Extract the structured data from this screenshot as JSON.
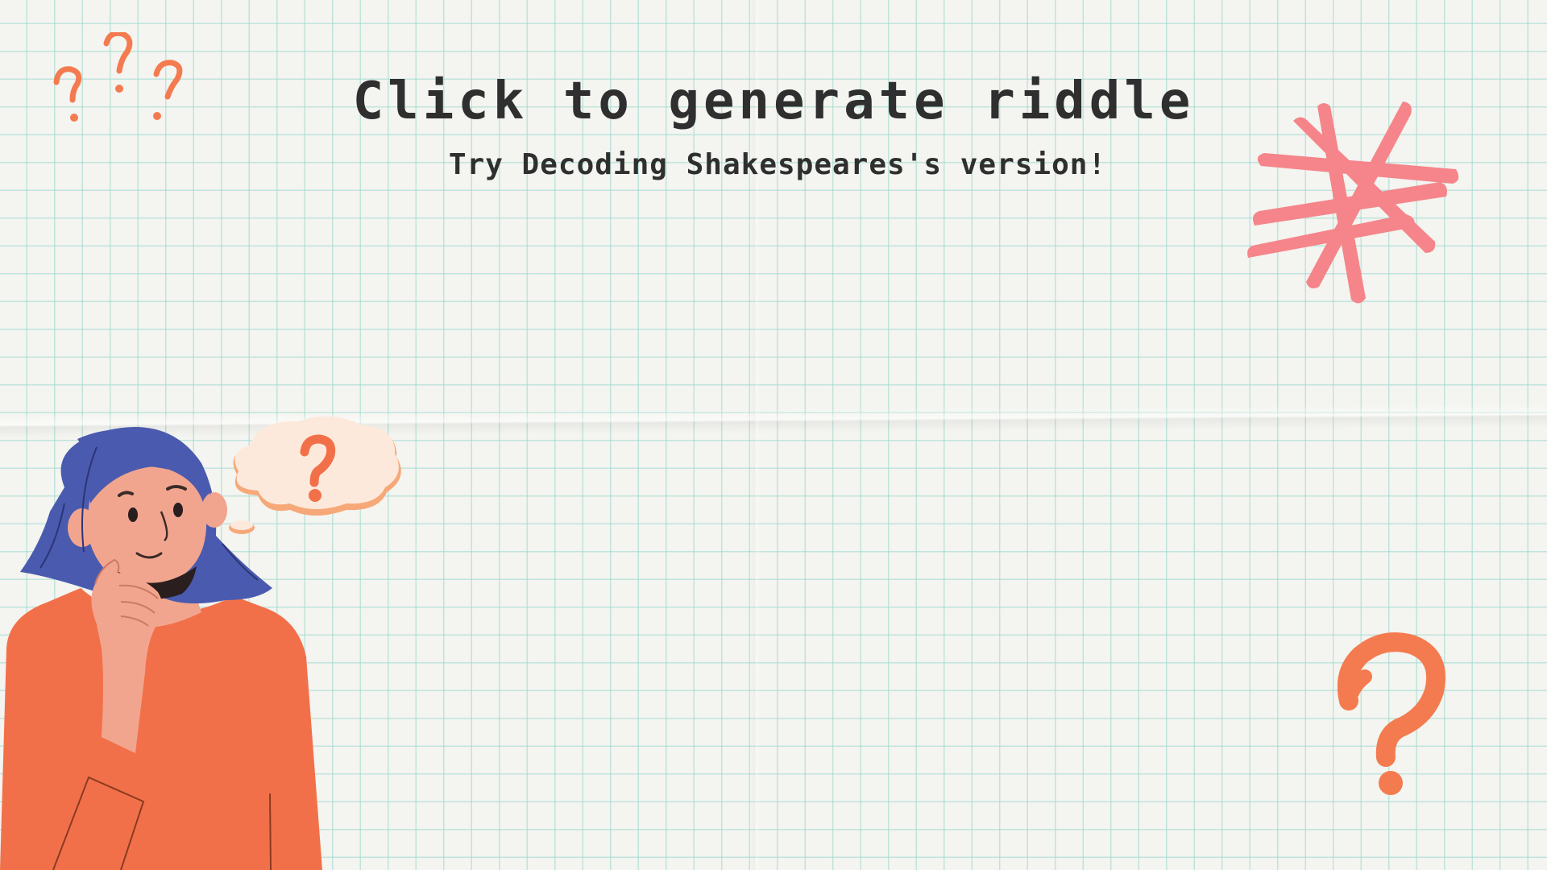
{
  "title": {
    "label": "Click to generate riddle"
  },
  "subtitle": {
    "text": "Try Decoding Shakespeares's version!"
  },
  "colors": {
    "text": "#2f2f2f",
    "grid": "#96d7cd",
    "paper": "#f4f4f0",
    "orange": "#f47b4f",
    "pink": "#f5858a",
    "hair": "#4a5aae",
    "skin": "#f2a58e",
    "shirt": "#f27049",
    "bubble": "#fde9dc"
  },
  "decorations": {
    "top_left": "question-marks-cluster",
    "top_right": "asterisk-shape",
    "bottom_right": "question-mark",
    "bottom_left": "thinking-woman-illustration",
    "thought_bubble": "thought-bubble-question"
  }
}
